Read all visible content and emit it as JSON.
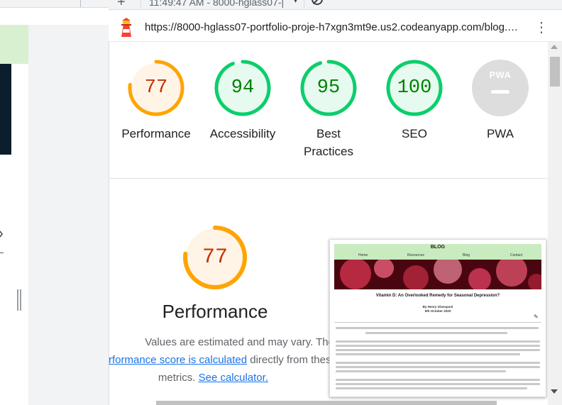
{
  "toolbar": {
    "new_button": "+",
    "timestamp": "11:49:47 AM - 8000-hglass07-|",
    "dropdown_arrow": "▾"
  },
  "address": {
    "url": "https://8000-hglass07-portfolio-proje-h7xgn3mt9e.us2.codeanyapp.com/blog.…",
    "menu_icon": "⋮"
  },
  "gauges": [
    {
      "id": "performance",
      "score": "77",
      "label": "Performance",
      "color": "#ffa400",
      "text_color": "#c33300",
      "bg": "#fff4e6",
      "value": 0.77
    },
    {
      "id": "accessibility",
      "score": "94",
      "label": "Accessibility",
      "color": "#0cce6b",
      "text_color": "#008000",
      "bg": "#e6faef",
      "value": 0.94
    },
    {
      "id": "best-practices",
      "score": "95",
      "label_line1": "Best",
      "label_line2": "Practices",
      "color": "#0cce6b",
      "text_color": "#008000",
      "bg": "#e6faef",
      "value": 0.95
    },
    {
      "id": "seo",
      "score": "100",
      "label": "SEO",
      "color": "#0cce6b",
      "text_color": "#008000",
      "bg": "#e6faef",
      "value": 1.0
    },
    {
      "id": "pwa",
      "badge_text": "PWA",
      "label": "PWA",
      "color": "#dddddd"
    }
  ],
  "performance_section": {
    "score": "77",
    "title": "Performance",
    "desc_line1": "Values are estimated and may vary. The",
    "desc_link1": "rformance score is calculated",
    "desc_line2_rest": " directly from these",
    "desc_line3_pre": "metrics. ",
    "desc_link2": "See calculator."
  },
  "thumbnail": {
    "site_title": "BLOG",
    "nav": [
      "Home",
      "Resources",
      "Blog",
      "Contact"
    ],
    "article_title": "Vitamin D: An Overlooked Remedy for Seasonal Depression?",
    "author": "By Henry Glasspool",
    "date": "9th October 2020",
    "edit_icon": "✎"
  }
}
